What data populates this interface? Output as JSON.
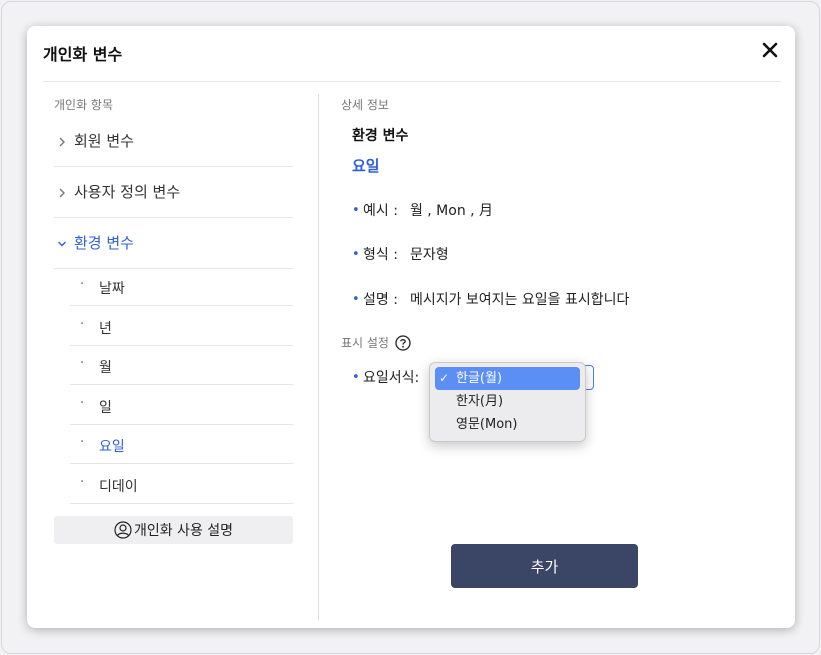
{
  "modal": {
    "title": "개인화 변수",
    "close_icon": "close-icon"
  },
  "left": {
    "caption": "개인화 항목",
    "categories": [
      {
        "label": "회원 변수",
        "active": false
      },
      {
        "label": "사용자 정의 변수",
        "active": false
      },
      {
        "label": "환경 변수",
        "active": true
      }
    ],
    "sub_items": [
      {
        "label": "날짜",
        "active": false
      },
      {
        "label": "년",
        "active": false
      },
      {
        "label": "월",
        "active": false
      },
      {
        "label": "일",
        "active": false
      },
      {
        "label": "요일",
        "active": true
      },
      {
        "label": "디데이",
        "active": false
      }
    ],
    "help_button": "개인화 사용 설명",
    "help_icon": "user-circle-icon",
    "bullet_char": "·"
  },
  "right": {
    "caption": "상세 정보",
    "section_heading": "환경 변수",
    "variable_name": "요일",
    "info": [
      {
        "key": "예시 :",
        "value": "월 , Mon , 月"
      },
      {
        "key": "형식 :",
        "value": "문자형"
      },
      {
        "key": "설명 :",
        "value": "메시지가 보여지는 요일을 표시합니다"
      }
    ],
    "display_caption": "표시 설정",
    "select_label": "요일서식:",
    "options": [
      {
        "label": "한글(월)",
        "selected": true
      },
      {
        "label": "한자(月)",
        "selected": false
      },
      {
        "label": "영문(Mon)",
        "selected": false
      }
    ],
    "check_char": "✓",
    "bullet_char": "•",
    "add_button": "추가"
  },
  "colors": {
    "accent": "#2f5fd9",
    "selected_option": "#5b8ff5",
    "primary_button": "#3b4566"
  }
}
